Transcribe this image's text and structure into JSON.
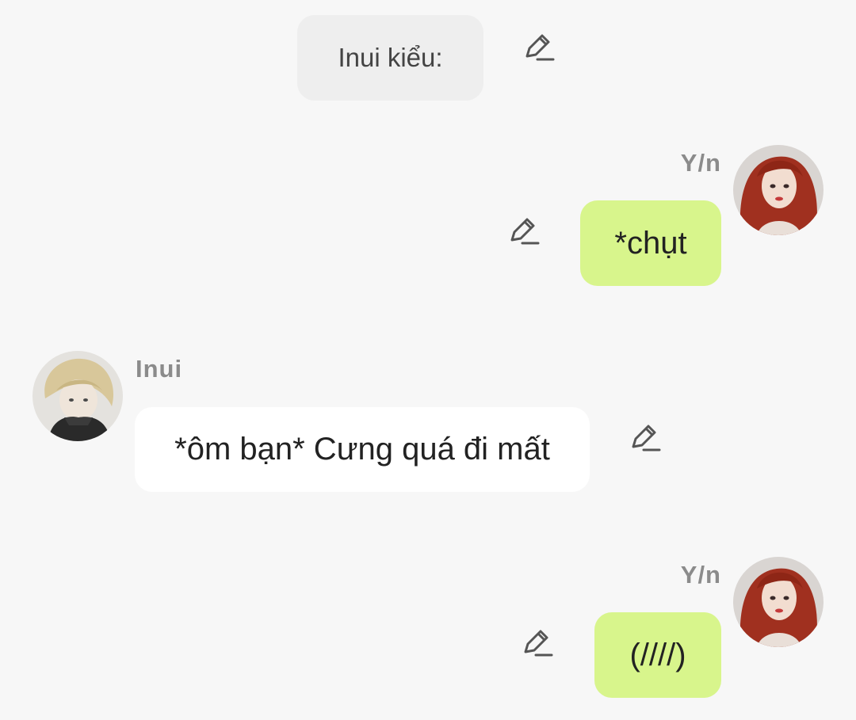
{
  "messages": [
    {
      "type": "narration",
      "text": "Inui kiểu:"
    },
    {
      "type": "outgoing",
      "sender": "Y/n",
      "text": "*chụt"
    },
    {
      "type": "incoming",
      "sender": "Inui",
      "text": "*ôm bạn* Cưng quá đi mất"
    },
    {
      "type": "outgoing",
      "sender": "Y/n",
      "text": "(////)"
    }
  ],
  "icons": {
    "edit": "pencil-edit-icon",
    "avatar_yn": "avatar-red-hair-girl",
    "avatar_inui": "avatar-blond-boy"
  },
  "colors": {
    "background": "#f7f7f7",
    "outgoing_bubble": "#d8f58c",
    "incoming_bubble": "#ffffff",
    "narration_bubble": "#eeeeee",
    "sender_name": "#8b8b8b"
  }
}
